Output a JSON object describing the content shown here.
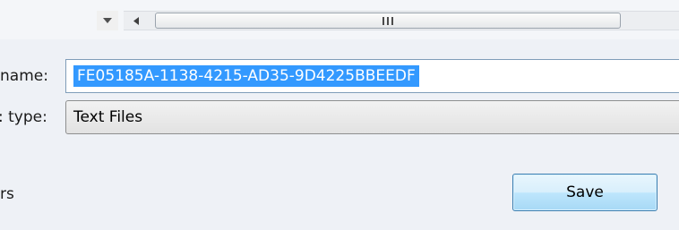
{
  "scrollbar": {
    "left_arrow_glyph": "◀",
    "dropdown_glyph": "▼",
    "thumb_grip": "III"
  },
  "form": {
    "name_label": "name:",
    "name_value": "FE05185A-1138-4215-AD35-9D4225BBEEDF",
    "type_label": ": type:",
    "type_value": "Text Files",
    "bottom_left_label": "rs",
    "save_label": "Save"
  },
  "colors": {
    "selection": "#3399ff",
    "panel": "#eef1f6",
    "button_border": "#3c7fb1"
  }
}
